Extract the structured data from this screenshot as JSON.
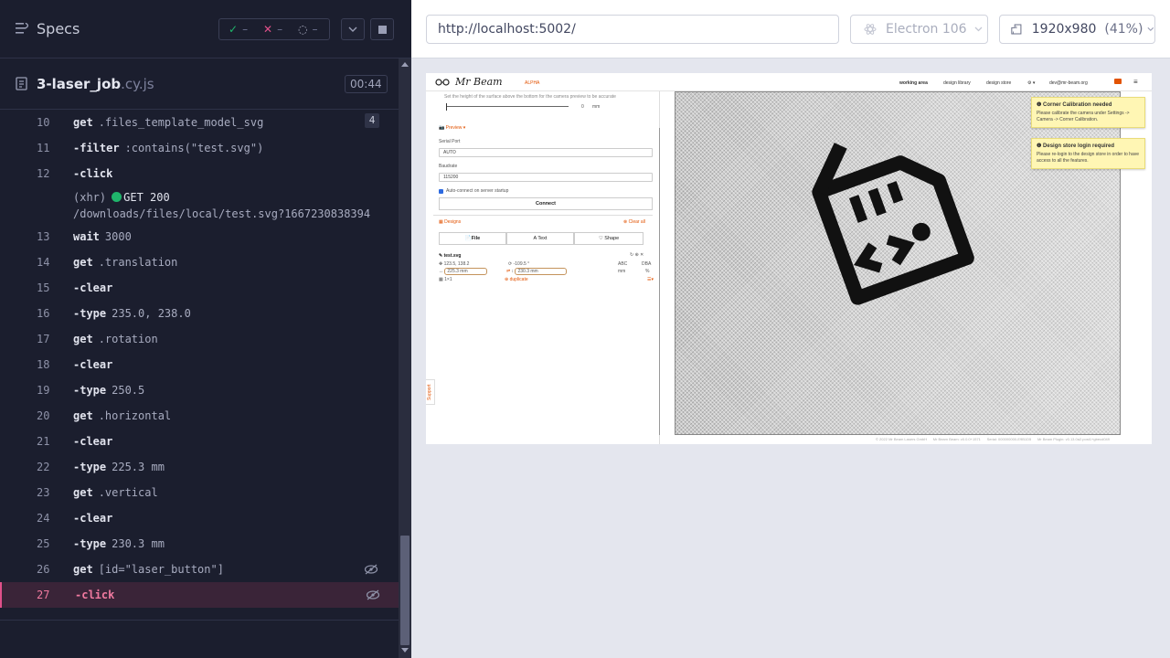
{
  "runner": {
    "specs_title": "Specs",
    "stats": {
      "passed": "–",
      "failed": "–",
      "pending": "–"
    },
    "file": {
      "name": "3-laser_job",
      "ext": ".cy.js",
      "duration": "00:44"
    },
    "commands": [
      {
        "num": "10",
        "name": "get",
        "msg": ".files_template_model_svg",
        "badge": "4"
      },
      {
        "num": "11",
        "name": "-filter",
        "msg": ":contains(\"test.svg\")"
      },
      {
        "num": "12",
        "name": "-click",
        "msg": ""
      },
      {
        "num": "13",
        "name": "wait",
        "msg": "3000"
      },
      {
        "num": "14",
        "name": "get",
        "msg": ".translation"
      },
      {
        "num": "15",
        "name": "-clear",
        "msg": ""
      },
      {
        "num": "16",
        "name": "-type",
        "msg": "235.0, 238.0"
      },
      {
        "num": "17",
        "name": "get",
        "msg": ".rotation"
      },
      {
        "num": "18",
        "name": "-clear",
        "msg": ""
      },
      {
        "num": "19",
        "name": "-type",
        "msg": "250.5"
      },
      {
        "num": "20",
        "name": "get",
        "msg": ".horizontal"
      },
      {
        "num": "21",
        "name": "-clear",
        "msg": ""
      },
      {
        "num": "22",
        "name": "-type",
        "msg": "225.3 mm"
      },
      {
        "num": "23",
        "name": "get",
        "msg": ".vertical"
      },
      {
        "num": "24",
        "name": "-clear",
        "msg": ""
      },
      {
        "num": "25",
        "name": "-type",
        "msg": "230.3 mm"
      },
      {
        "num": "26",
        "name": "get",
        "msg": "[id=\"laser_button\"]"
      },
      {
        "num": "27",
        "name": "-click",
        "msg": ""
      }
    ],
    "xhr": {
      "label": "(xhr)",
      "status": "GET 200",
      "url": "/downloads/files/local/test.svg?1667230838394"
    }
  },
  "browser": {
    "url": "http://localhost:5002/",
    "browser_name": "Electron 106",
    "viewport": "1920x980",
    "scale": "(41%)"
  },
  "app": {
    "logo": "Mr Beam",
    "alpha": "ALPHA",
    "nav": [
      "working area",
      "design library",
      "design store",
      "dev@mr-beam.org"
    ],
    "height_hint": "Set the height of the surface above the bottom for the camera preview to be accurate",
    "slider_value": "0",
    "slider_unit": "mm",
    "preview_label": "Preview",
    "serial_port_label": "Serial Port",
    "serial_port_value": "AUTO",
    "baudrate_label": "Baudrate",
    "baudrate_value": "115200",
    "autoconnect_label": "Auto-connect on server startup",
    "connect_label": "Connect",
    "designs_label": "Designs",
    "clear_all_label": "Clear all",
    "tabs": [
      "File",
      "Text",
      "Shape"
    ],
    "design_item": {
      "name": "test.svg",
      "translation": "123.5, 138.2",
      "rotation": "-109.5 °",
      "width": "225.3 mm",
      "height": "230.3 mm",
      "multiply": "1×1",
      "duplicate": "duplicate",
      "unit_abc": "ABC",
      "unit_mm": "mm",
      "unit_pct": "%",
      "unit_dba": "DBA"
    },
    "notices": [
      {
        "title": "Corner Calibration needed",
        "text": "Please calibrate the camera under Settings -> Camera -> Corner Calibration."
      },
      {
        "title": "Design store login required",
        "text": "Please re-login to the design store in order to have access to all the features."
      }
    ],
    "footer": [
      "© 2022 Mr Beam Lasers GmbH",
      "Mr Beam Beam: v0.0.0+1571",
      "Serial: 000000000-E9B1D5",
      "Mr Beam Plugin: v0.13.0a2.post1+gbecd049"
    ],
    "support_label": "Support"
  },
  "colors": {
    "accent": "#e25303",
    "active_cmd": "#f07aa0",
    "pass": "#1fb56b",
    "fail": "#e0508a"
  }
}
